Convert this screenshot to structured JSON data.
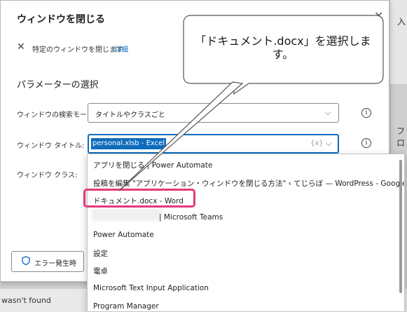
{
  "background": {
    "right_label_top": "入",
    "right_label_mid": "フロ",
    "status_text": "wasn't found"
  },
  "dialog": {
    "title": "ウィンドウを閉じる",
    "description": "特定のウィンドウを閉じます",
    "detail_link": "詳細",
    "section_title": "パラメーターの選択",
    "search_mode": {
      "label": "ウィンドウの検索モード:",
      "value": "タイトルやクラスごと"
    },
    "window_title": {
      "label": "ウィンドウ タイトル:",
      "value": "personal.xlsb - Excel",
      "variable_token": "{x}"
    },
    "window_class": {
      "label": "ウィンドウ クラス:"
    },
    "error_button": "エラー発生時",
    "info_glyph": "i"
  },
  "dropdown": {
    "items": [
      "アプリを閉じる | Power Automate",
      "投稿を編集 \"アプリケーション・ウィンドウを閉じる方法\" ‹ てじらぼ — WordPress - Google Chrome",
      "ドキュメント.docx - Word",
      "| Microsoft Teams",
      "Power Automate",
      "設定",
      "電卓",
      "Microsoft Text Input Application",
      "Program Manager"
    ],
    "highlighted_index": 2
  },
  "callout": {
    "line1": "「ドキュメント.docx」を選択しま",
    "line2": "す。"
  },
  "colors": {
    "accent": "#0f6cbd",
    "highlight": "#e33a7a"
  }
}
